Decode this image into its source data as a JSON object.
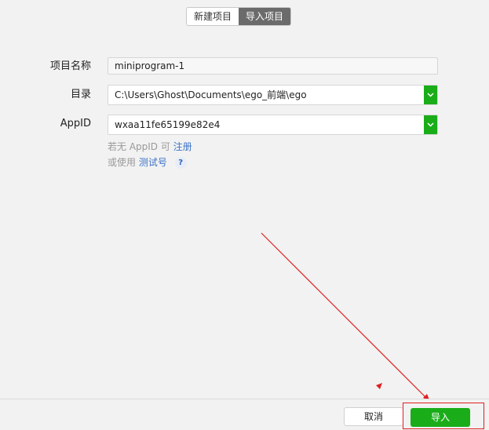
{
  "tabs": [
    {
      "label": "新建项目",
      "active": false
    },
    {
      "label": "导入项目",
      "active": true
    }
  ],
  "form": {
    "project_name_label": "项目名称",
    "project_name_value": "miniprogram-1",
    "directory_label": "目录",
    "directory_value": "C:\\Users\\Ghost\\Documents\\ego_前端\\ego",
    "appid_label": "AppID",
    "appid_value": "wxaa11fe65199e82e4"
  },
  "hints": {
    "no_appid_prefix": "若无 AppID 可",
    "register_link": "注册",
    "or_use_prefix": "或使用",
    "test_account_link": "测试号",
    "help_mark": "?"
  },
  "footer": {
    "cancel_label": "取消",
    "import_label": "导入"
  },
  "colors": {
    "accent_green": "#1aad19",
    "annotation_red": "#e02020",
    "link_blue": "#3b73c8"
  }
}
